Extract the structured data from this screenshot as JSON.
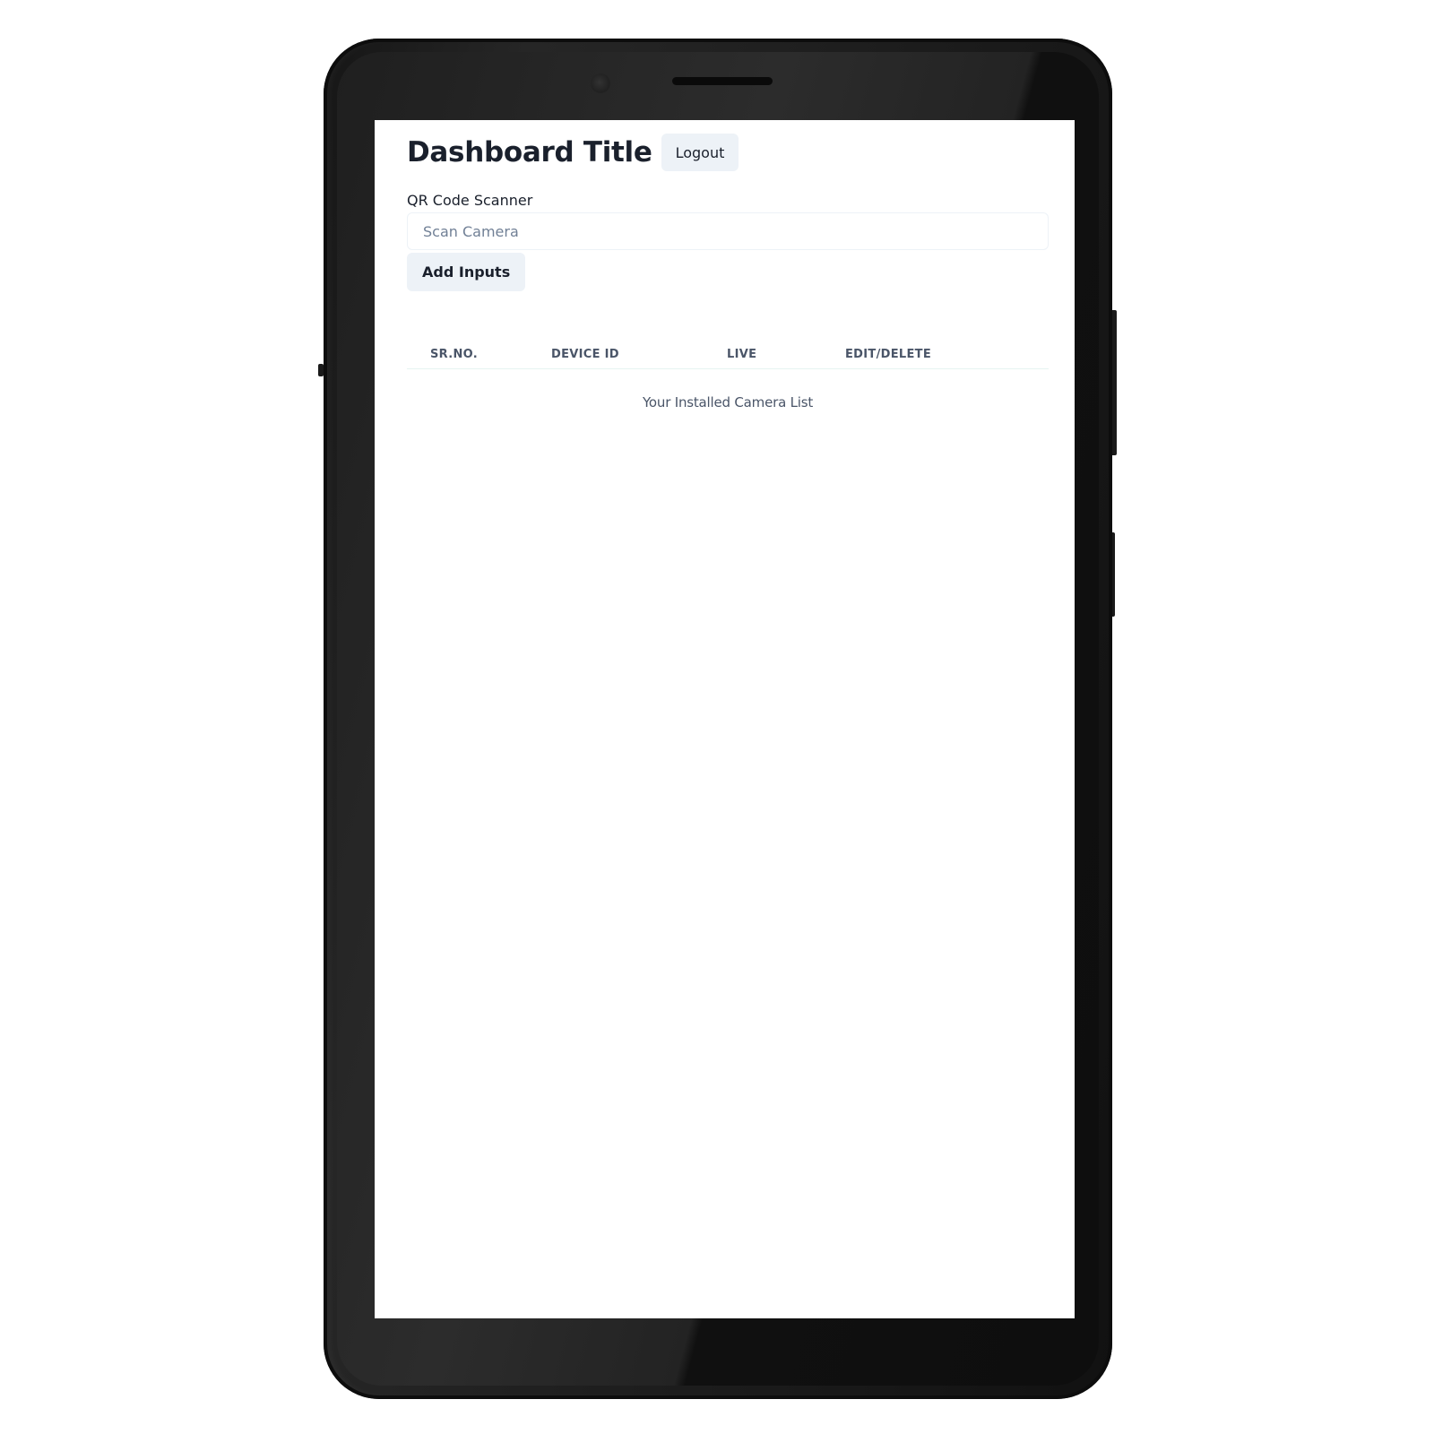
{
  "header": {
    "title": "Dashboard Title",
    "logout_label": "Logout"
  },
  "scanner": {
    "label": "QR Code Scanner",
    "placeholder": "Scan Camera",
    "value": "",
    "add_label": "Add Inputs"
  },
  "table": {
    "columns": [
      "SR.NO.",
      "DEVICE ID",
      "LIVE",
      "EDIT/DELETE"
    ],
    "rows": [],
    "caption": "Your Installed Camera List"
  },
  "colors": {
    "text": "#1a202c",
    "muted": "#4a5568",
    "button_bg": "#edf2f7",
    "frame": "#1f1f1f"
  }
}
